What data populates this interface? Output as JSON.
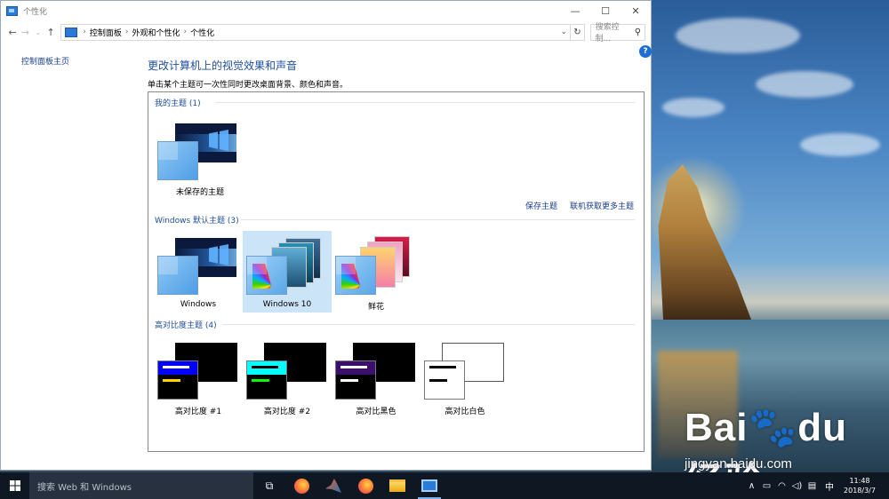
{
  "window": {
    "title": "个性化",
    "minimize": "—",
    "maximize": "☐",
    "close": "✕"
  },
  "address": {
    "breadcrumbs": [
      "控制面板",
      "外观和个性化",
      "个性化"
    ],
    "search_placeholder": "搜索控制..."
  },
  "sidebar": {
    "home_link": "控制面板主页"
  },
  "main": {
    "heading": "更改计算机上的视觉效果和声音",
    "subheading": "单击某个主题可一次性同时更改桌面背景、颜色和声音。",
    "groups": [
      {
        "title": "我的主题 (1)",
        "themes": [
          {
            "label": "未保存的主题"
          }
        ],
        "links": [
          "保存主题",
          "联机获取更多主题"
        ]
      },
      {
        "title": "Windows 默认主题 (3)",
        "themes": [
          {
            "label": "Windows"
          },
          {
            "label": "Windows 10",
            "selected": true
          },
          {
            "label": "鲜花"
          }
        ]
      },
      {
        "title": "高对比度主题 (4)",
        "themes": [
          {
            "label": "高对比度 #1",
            "bar": "#0000ff",
            "line1": "#ffffff",
            "line2": "#ffd400",
            "bg": "#000000"
          },
          {
            "label": "高对比度 #2",
            "bar": "#00ffff",
            "line1": "#000000",
            "line2": "#00ff00",
            "bg": "#000000"
          },
          {
            "label": "高对比黑色",
            "bar": "#3c0f6e",
            "line1": "#ffffff",
            "line2": "#ffffff",
            "bg": "#000000"
          },
          {
            "label": "高对比白色",
            "bar": "#ffffff",
            "line1": "#000000",
            "line2": "#000000",
            "bg": "#ffffff"
          }
        ]
      }
    ]
  },
  "taskbar": {
    "search_placeholder": "搜索 Web 和 Windows",
    "ime": "中",
    "time": "11:48",
    "date": "2018/3/7"
  },
  "watermark": {
    "brand": "Bai",
    "brand2": "经验",
    "url": "jingyan.baidu.com"
  },
  "colors": {
    "accent": "#1e4e9c",
    "selection": "#cce4f7",
    "taskbar": "#0f1722"
  }
}
